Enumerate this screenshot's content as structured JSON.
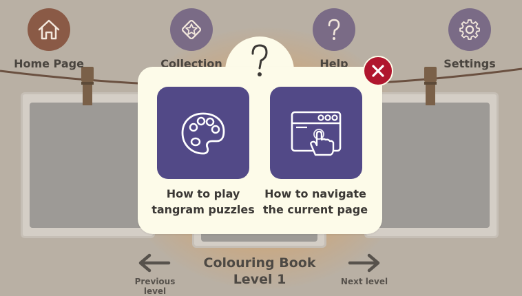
{
  "nav": {
    "home": {
      "label": "Home Page",
      "color": "#8a5a46",
      "icon": "house-icon"
    },
    "collection": {
      "label": "Collection",
      "color": "#7a6b86",
      "icon": "star-badge-icon"
    },
    "help": {
      "label": "Help",
      "color": "#7a6b86",
      "icon": "question-mark-icon"
    },
    "settings": {
      "label": "Settings",
      "color": "#7a6b86",
      "icon": "gear-icon"
    }
  },
  "help_popup": {
    "header_icon": "question-mark-icon",
    "options": [
      {
        "line1": "How to play",
        "line2": "tangram puzzles",
        "icon": "palette-icon"
      },
      {
        "line1": "How to navigate",
        "line2": "the current page",
        "icon": "browser-click-icon"
      }
    ],
    "close_icon": "close-icon",
    "tile_color": "#524987"
  },
  "footer": {
    "title_line1": "Colouring Book",
    "title_line2": "Level 1",
    "previous_label": "Previous level",
    "next_label": "Next level"
  }
}
